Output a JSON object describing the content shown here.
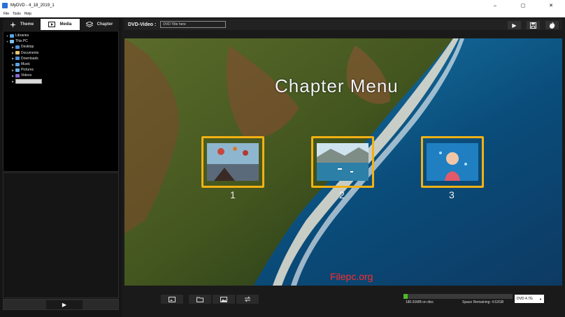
{
  "window": {
    "title": "MyDVD - 4_18_2019_1",
    "minimize": "–",
    "maximize": "▢",
    "close": "✕"
  },
  "menu": {
    "items": [
      "File",
      "Tools",
      "Help"
    ]
  },
  "leftTabs": [
    {
      "label": "Theme"
    },
    {
      "label": "Media"
    },
    {
      "label": "Chapter"
    }
  ],
  "tree": [
    {
      "label": "Libraries",
      "level": 0,
      "expanded": true
    },
    {
      "label": "This PC",
      "level": 0,
      "expanded": true
    },
    {
      "label": "Desktop",
      "level": 1
    },
    {
      "label": "Documents",
      "level": 1
    },
    {
      "label": "Downloads",
      "level": 1
    },
    {
      "label": "Music",
      "level": 1
    },
    {
      "label": "Pictures",
      "level": 1
    },
    {
      "label": "Videos",
      "level": 1
    },
    {
      "label": "",
      "level": 1,
      "selected": true
    }
  ],
  "editor": {
    "label": "DVD-Video :",
    "titlePlaceholder": "DVD Title here",
    "menuTitle": "Chapter Menu",
    "chapters": [
      "1",
      "2",
      "3"
    ],
    "watermark": "Filepc.org"
  },
  "status": {
    "used": "180.91MB on disc",
    "remaining": "Space Remaining: 4.52GB",
    "disc": "DVD 4.7G",
    "usedFraction": 0.04
  },
  "colors": {
    "accent": "#f3b113",
    "meter": "#4dbb2a",
    "watermark": "#ff2b2b"
  },
  "icons": {
    "play": "▶",
    "save": "save-icon",
    "burn": "flame-icon"
  }
}
